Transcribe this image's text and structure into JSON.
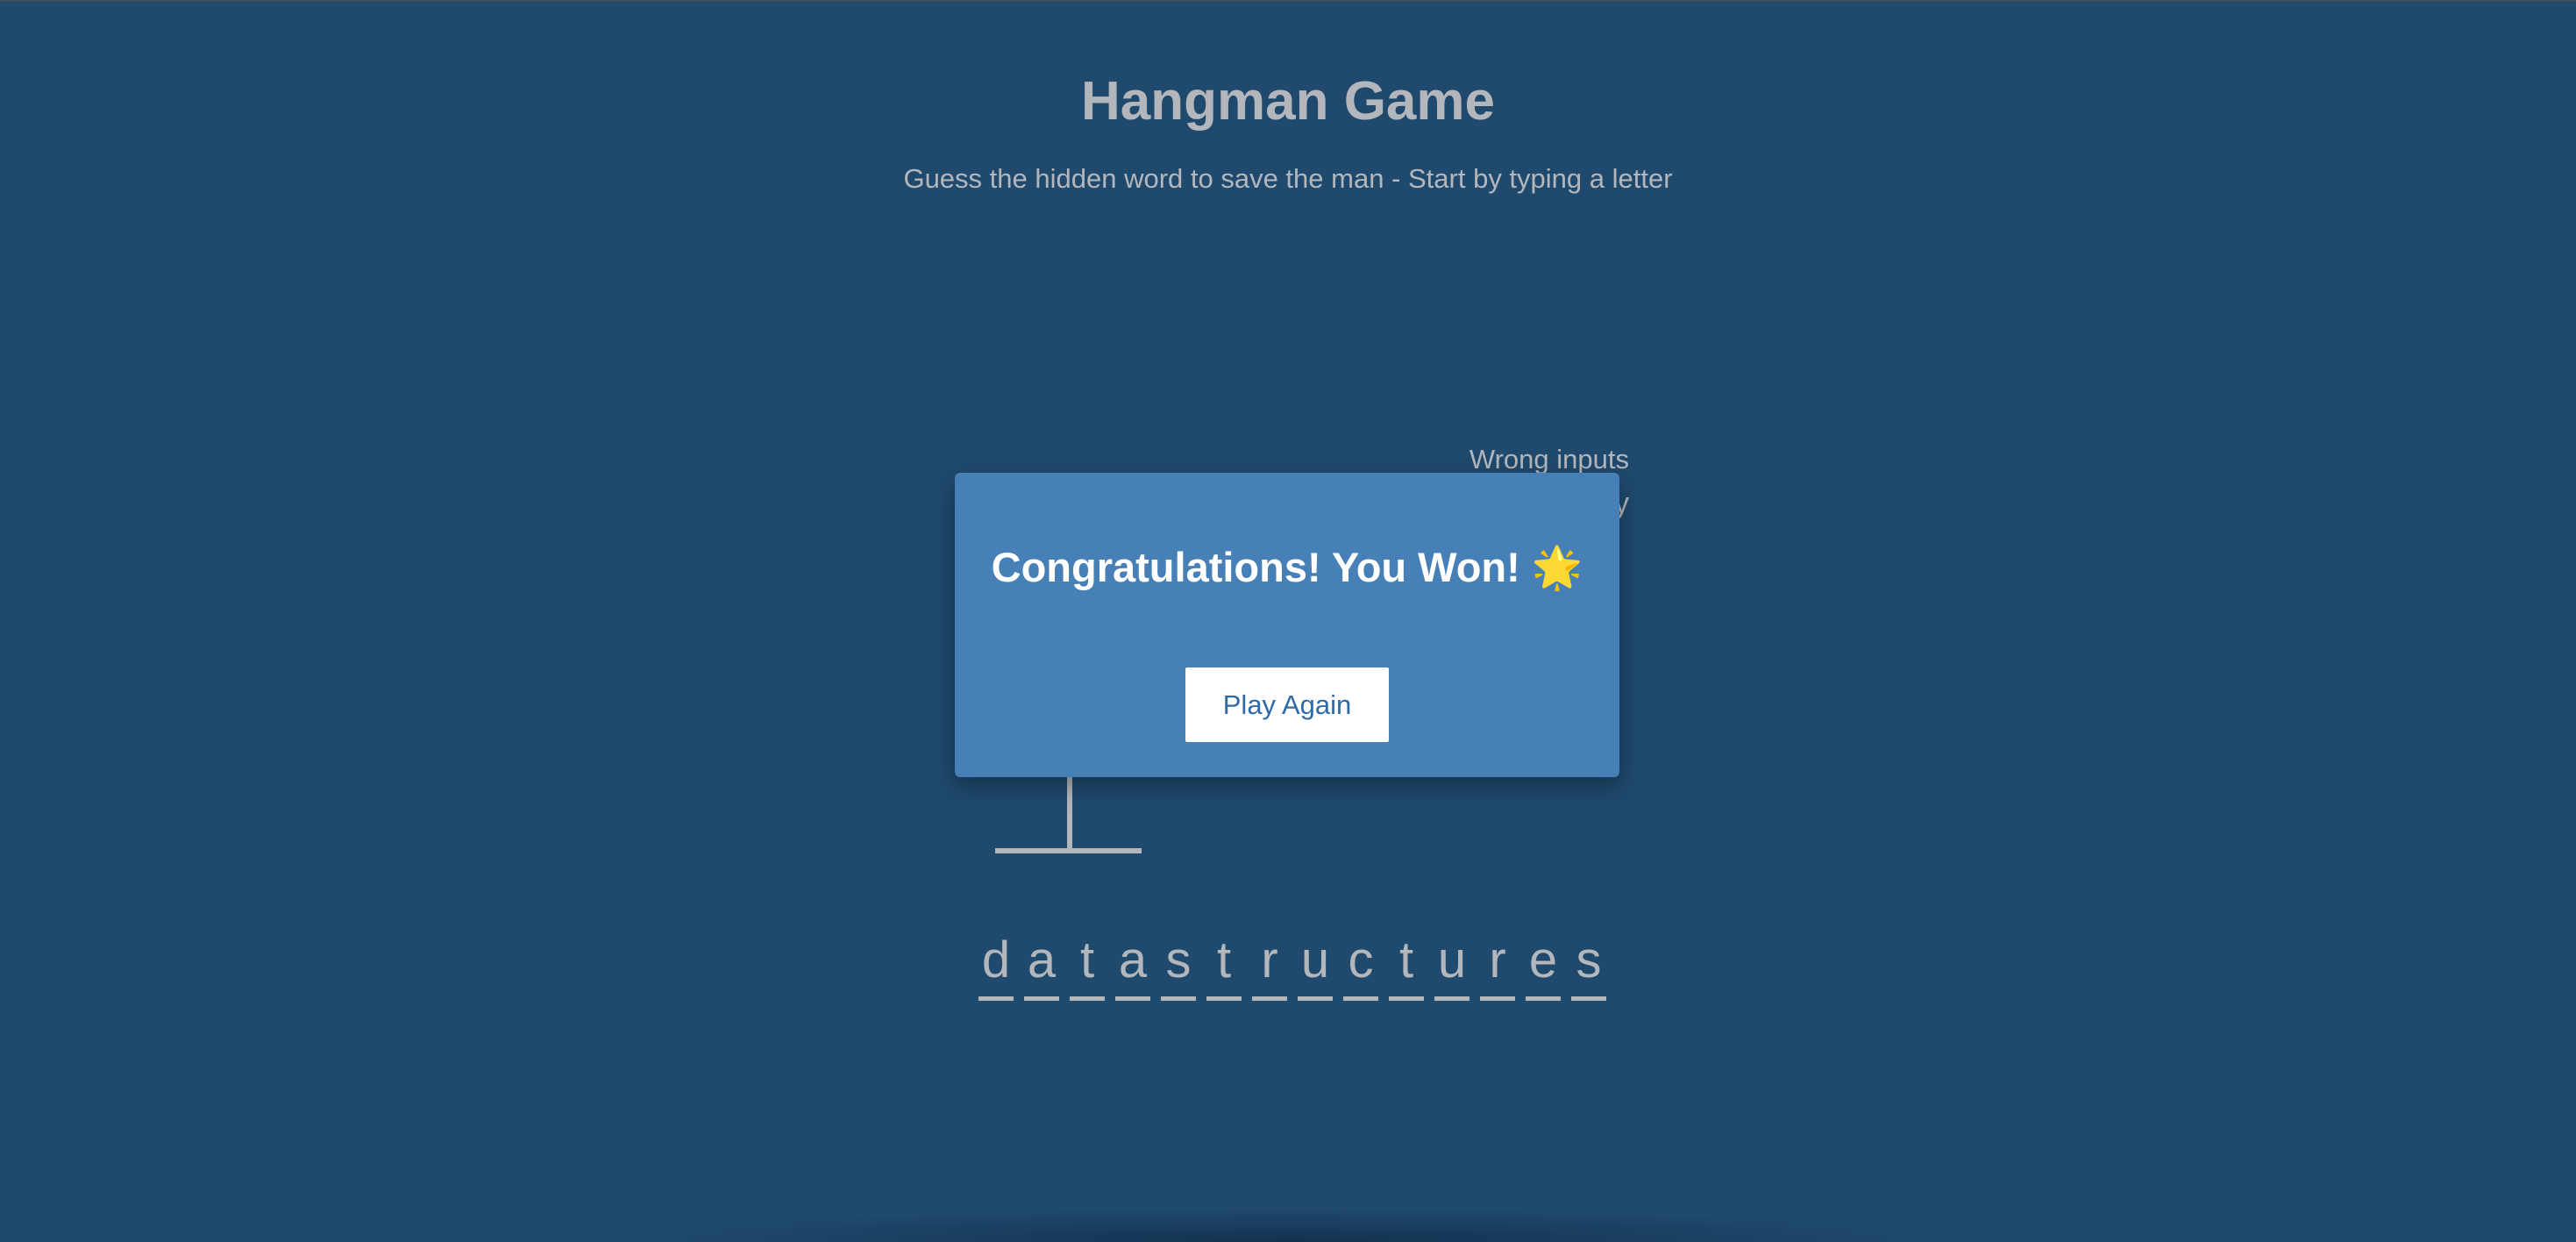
{
  "header": {
    "title": "Hangman Game",
    "subtitle": "Guess the hidden word to save the man - Start by typing a letter"
  },
  "wrong_inputs": {
    "label": "Wrong inputs",
    "letters": "y"
  },
  "modal": {
    "message": "Congratulations! You Won! 🌟",
    "play_again_label": "Play Again"
  },
  "word": {
    "letters": [
      "d",
      "a",
      "t",
      "a",
      "s",
      "t",
      "r",
      "u",
      "c",
      "t",
      "u",
      "r",
      "e",
      "s"
    ]
  },
  "colors": {
    "background": "#1f4a6e",
    "modal": "#4680b6",
    "text": "#b3b7bc",
    "button_text": "#2d6aa6"
  }
}
